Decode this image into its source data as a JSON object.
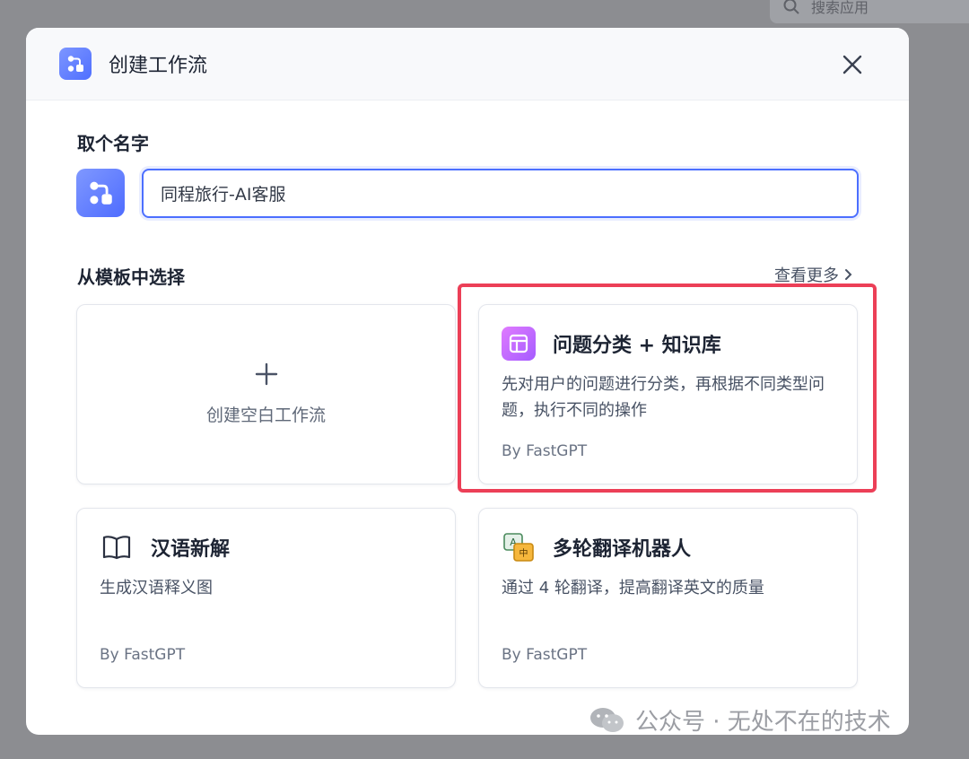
{
  "background": {
    "search_placeholder": "搜索应用"
  },
  "modal": {
    "title": "创建工作流",
    "name_section_label": "取个名字",
    "name_value": "同程旅行-AI客服",
    "template_section_label": "从模板中选择",
    "see_more": "查看更多",
    "blank_card_label": "创建空白工作流",
    "templates": [
      {
        "title": "问题分类 + 知识库",
        "description": "先对用户的问题进行分类，再根据不同类型问题，执行不同的操作",
        "author": "By FastGPT",
        "icon": "layout-panel-icon"
      },
      {
        "title": "汉语新解",
        "description": "生成汉语释义图",
        "author": "By FastGPT",
        "icon": "book-icon"
      },
      {
        "title": "多轮翻译机器人",
        "description": "通过 4 轮翻译，提高翻译英文的质量",
        "author": "By FastGPT",
        "icon": "translate-icon"
      }
    ]
  },
  "watermark": "公众号 · 无处不在的技术",
  "colors": {
    "accent": "#4c6fff",
    "highlight": "#ec3f57",
    "text_primary": "#1d2433",
    "text_secondary": "#485264"
  }
}
